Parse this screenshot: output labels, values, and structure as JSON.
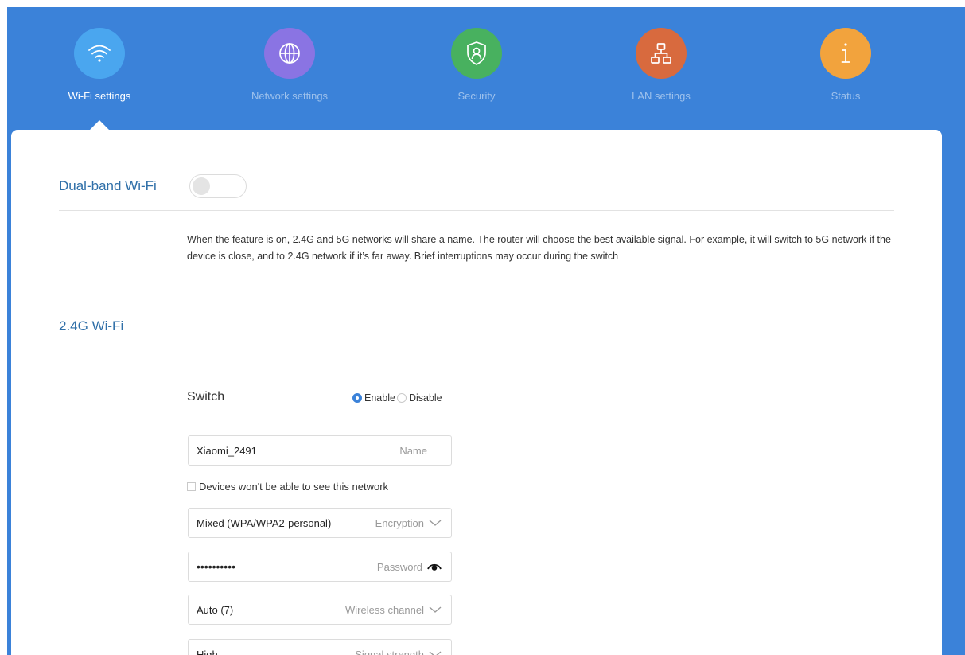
{
  "nav": {
    "items": [
      {
        "label": "Wi-Fi settings",
        "icon": "wifi-icon",
        "color": "#4aa6ef",
        "active": true
      },
      {
        "label": "Network settings",
        "icon": "globe-icon",
        "color": "#8a74e3",
        "active": false
      },
      {
        "label": "Security",
        "icon": "shield-icon",
        "color": "#48b15f",
        "active": false
      },
      {
        "label": "LAN settings",
        "icon": "lan-icon",
        "color": "#d86a3e",
        "active": false
      },
      {
        "label": "Status",
        "icon": "info-icon",
        "color": "#f2a33d",
        "active": false
      }
    ]
  },
  "dual_band": {
    "title": "Dual-band Wi-Fi",
    "enabled": false,
    "description": "When the feature is on, 2.4G and 5G networks will share a name. The router will choose the best available signal. For example, it will switch to 5G network if the device is close, and to 2.4G network if it’s far away. Brief interruptions may occur during the switch"
  },
  "wifi_24": {
    "title": "2.4G Wi-Fi",
    "switch_label": "Switch",
    "enable_label": "Enable",
    "disable_label": "Disable",
    "selected": "Enable",
    "name": {
      "value": "Xiaomi_2491",
      "hint": "Name"
    },
    "hidden_label": "Devices won't be able to see this network",
    "hidden_checked": false,
    "encryption": {
      "value": "Mixed (WPA/WPA2-personal)",
      "hint": "Encryption"
    },
    "password": {
      "value": "••••••••••",
      "hint": "Password"
    },
    "channel": {
      "value": "Auto (7)",
      "hint": "Wireless channel"
    },
    "signal": {
      "value": "High",
      "hint": "Signal strength"
    }
  },
  "colors": {
    "background": "#3b82d9",
    "accent": "#2f6fa8"
  }
}
